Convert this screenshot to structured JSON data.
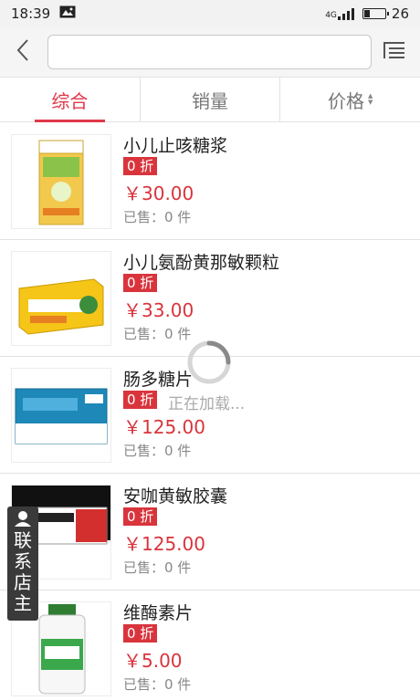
{
  "status_bar": {
    "time": "18:39",
    "network": "4G",
    "battery": "26",
    "battery_level": 0.26
  },
  "header": {
    "search_value": "",
    "search_placeholder": ""
  },
  "tabs": [
    {
      "label": "综合",
      "active": true
    },
    {
      "label": "销量",
      "active": false
    },
    {
      "label": "价格",
      "active": false
    }
  ],
  "products": [
    {
      "name": "小儿止咳糖浆",
      "discount": "0 折",
      "price": "￥30.00",
      "sold": "已售：0 件",
      "thumb_text": "小儿止咳糖浆"
    },
    {
      "name": "小儿氨酚黄那敏颗粒",
      "discount": "0 折",
      "price": "￥33.00",
      "sold": "已售：0 件",
      "thumb_text": "小儿氨酚黄那敏颗粒"
    },
    {
      "name": "肠多糖片",
      "discount": "0 折",
      "price": "￥125.00",
      "sold": "已售：0 件",
      "thumb_text": "肠多糖片"
    },
    {
      "name": "安咖黄敏胶囊",
      "discount": "0 折",
      "price": "￥125.00",
      "sold": "已售：0 件",
      "thumb_text": "安咖黄敏胶囊"
    },
    {
      "name": "维酶素片",
      "discount": "0 折",
      "price": "￥5.00",
      "sold": "已售：0 件",
      "thumb_text": "维酶素片"
    }
  ],
  "loading": {
    "text": "正在加载..."
  },
  "contact": {
    "chars": [
      "联",
      "系",
      "店",
      "主"
    ]
  },
  "colors": {
    "accent": "#e0384a",
    "price": "#d9343c",
    "discount_bg": "#d9343c"
  },
  "icons": [
    "image-icon",
    "signal-icon",
    "battery-icon",
    "back-arrow-icon",
    "list-menu-icon",
    "sort-arrows-icon",
    "spinner-icon",
    "user-icon"
  ]
}
